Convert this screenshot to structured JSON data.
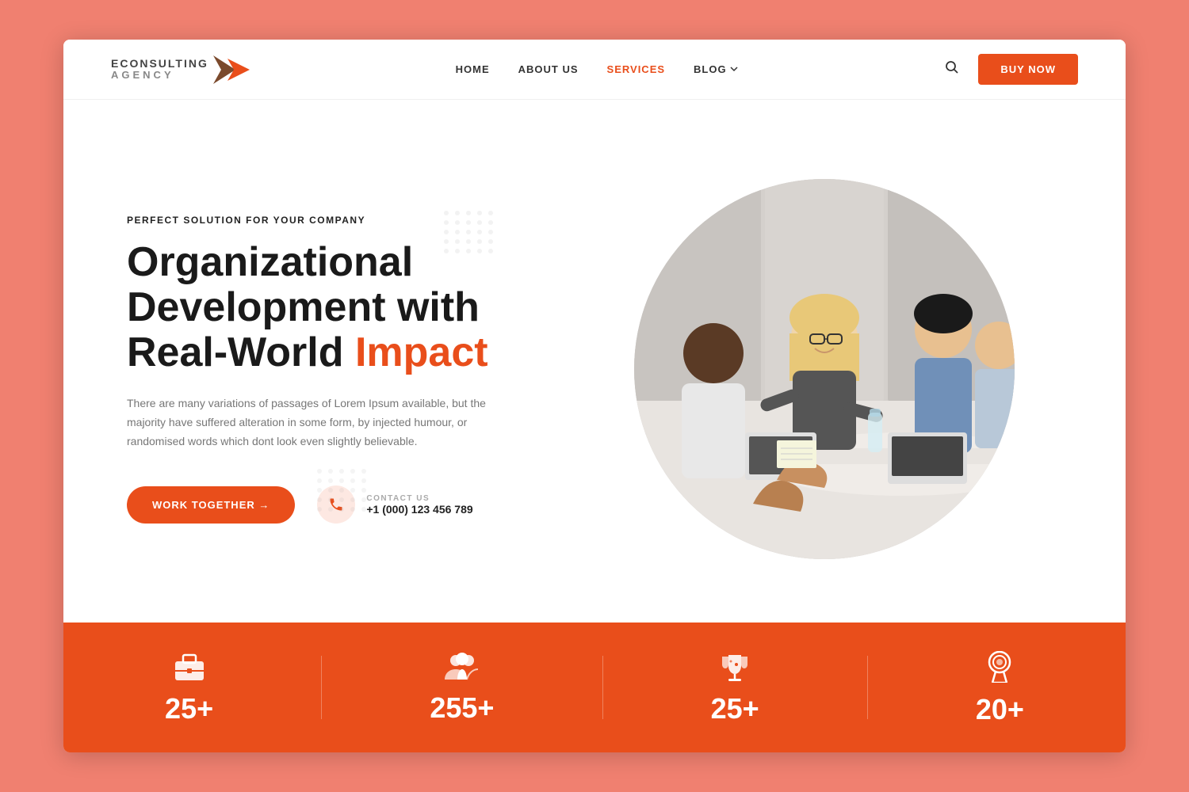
{
  "outer_bg": "#f08070",
  "brand": {
    "name_top": "ECONSULTING",
    "name_bottom": "AGENCY"
  },
  "nav": {
    "home": "HOME",
    "about": "ABOUT US",
    "services": "SERVICES",
    "blog": "BLOG",
    "buy_now": "BUY NOW"
  },
  "hero": {
    "subtitle": "PERFECT SOLUTION FOR YOUR COMPANY",
    "title_part1": "Organizational\nDevelopment with\nReal-World ",
    "title_highlight": "Impact",
    "description": "There are many variations of passages of Lorem Ipsum available, but the majority have suffered alteration in some form, by injected humour, or randomised words which dont look even slightly believable.",
    "cta_button": "WORK TOGETHER →",
    "contact_label": "CONTACT US",
    "contact_number": "+1 (000) 123 456 789"
  },
  "stats": [
    {
      "icon": "briefcase",
      "number": "25+"
    },
    {
      "icon": "people",
      "number": "255+"
    },
    {
      "icon": "trophy",
      "number": "25+"
    },
    {
      "icon": "award",
      "number": "20+"
    }
  ]
}
